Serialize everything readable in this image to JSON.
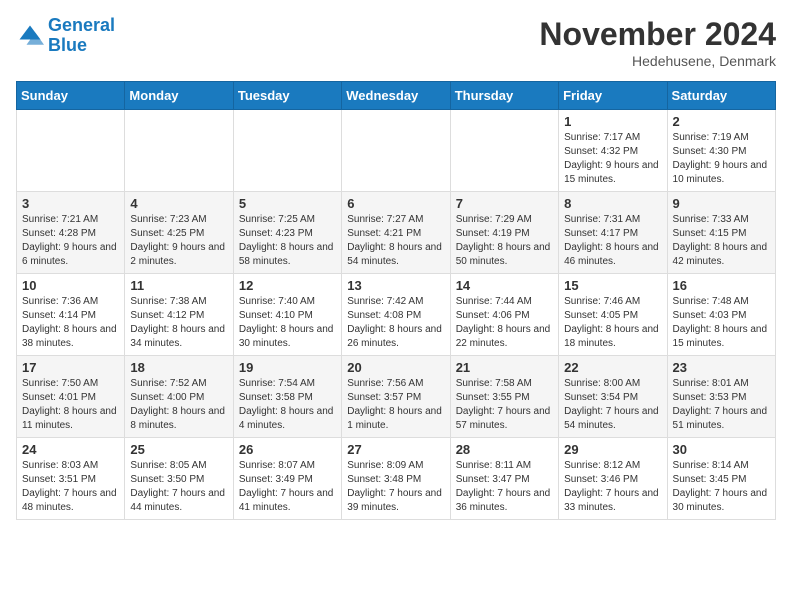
{
  "logo": {
    "line1": "General",
    "line2": "Blue"
  },
  "title": "November 2024",
  "location": "Hedehusene, Denmark",
  "days_of_week": [
    "Sunday",
    "Monday",
    "Tuesday",
    "Wednesday",
    "Thursday",
    "Friday",
    "Saturday"
  ],
  "weeks": [
    [
      {
        "day": "",
        "info": ""
      },
      {
        "day": "",
        "info": ""
      },
      {
        "day": "",
        "info": ""
      },
      {
        "day": "",
        "info": ""
      },
      {
        "day": "",
        "info": ""
      },
      {
        "day": "1",
        "info": "Sunrise: 7:17 AM\nSunset: 4:32 PM\nDaylight: 9 hours and 15 minutes."
      },
      {
        "day": "2",
        "info": "Sunrise: 7:19 AM\nSunset: 4:30 PM\nDaylight: 9 hours and 10 minutes."
      }
    ],
    [
      {
        "day": "3",
        "info": "Sunrise: 7:21 AM\nSunset: 4:28 PM\nDaylight: 9 hours and 6 minutes."
      },
      {
        "day": "4",
        "info": "Sunrise: 7:23 AM\nSunset: 4:25 PM\nDaylight: 9 hours and 2 minutes."
      },
      {
        "day": "5",
        "info": "Sunrise: 7:25 AM\nSunset: 4:23 PM\nDaylight: 8 hours and 58 minutes."
      },
      {
        "day": "6",
        "info": "Sunrise: 7:27 AM\nSunset: 4:21 PM\nDaylight: 8 hours and 54 minutes."
      },
      {
        "day": "7",
        "info": "Sunrise: 7:29 AM\nSunset: 4:19 PM\nDaylight: 8 hours and 50 minutes."
      },
      {
        "day": "8",
        "info": "Sunrise: 7:31 AM\nSunset: 4:17 PM\nDaylight: 8 hours and 46 minutes."
      },
      {
        "day": "9",
        "info": "Sunrise: 7:33 AM\nSunset: 4:15 PM\nDaylight: 8 hours and 42 minutes."
      }
    ],
    [
      {
        "day": "10",
        "info": "Sunrise: 7:36 AM\nSunset: 4:14 PM\nDaylight: 8 hours and 38 minutes."
      },
      {
        "day": "11",
        "info": "Sunrise: 7:38 AM\nSunset: 4:12 PM\nDaylight: 8 hours and 34 minutes."
      },
      {
        "day": "12",
        "info": "Sunrise: 7:40 AM\nSunset: 4:10 PM\nDaylight: 8 hours and 30 minutes."
      },
      {
        "day": "13",
        "info": "Sunrise: 7:42 AM\nSunset: 4:08 PM\nDaylight: 8 hours and 26 minutes."
      },
      {
        "day": "14",
        "info": "Sunrise: 7:44 AM\nSunset: 4:06 PM\nDaylight: 8 hours and 22 minutes."
      },
      {
        "day": "15",
        "info": "Sunrise: 7:46 AM\nSunset: 4:05 PM\nDaylight: 8 hours and 18 minutes."
      },
      {
        "day": "16",
        "info": "Sunrise: 7:48 AM\nSunset: 4:03 PM\nDaylight: 8 hours and 15 minutes."
      }
    ],
    [
      {
        "day": "17",
        "info": "Sunrise: 7:50 AM\nSunset: 4:01 PM\nDaylight: 8 hours and 11 minutes."
      },
      {
        "day": "18",
        "info": "Sunrise: 7:52 AM\nSunset: 4:00 PM\nDaylight: 8 hours and 8 minutes."
      },
      {
        "day": "19",
        "info": "Sunrise: 7:54 AM\nSunset: 3:58 PM\nDaylight: 8 hours and 4 minutes."
      },
      {
        "day": "20",
        "info": "Sunrise: 7:56 AM\nSunset: 3:57 PM\nDaylight: 8 hours and 1 minute."
      },
      {
        "day": "21",
        "info": "Sunrise: 7:58 AM\nSunset: 3:55 PM\nDaylight: 7 hours and 57 minutes."
      },
      {
        "day": "22",
        "info": "Sunrise: 8:00 AM\nSunset: 3:54 PM\nDaylight: 7 hours and 54 minutes."
      },
      {
        "day": "23",
        "info": "Sunrise: 8:01 AM\nSunset: 3:53 PM\nDaylight: 7 hours and 51 minutes."
      }
    ],
    [
      {
        "day": "24",
        "info": "Sunrise: 8:03 AM\nSunset: 3:51 PM\nDaylight: 7 hours and 48 minutes."
      },
      {
        "day": "25",
        "info": "Sunrise: 8:05 AM\nSunset: 3:50 PM\nDaylight: 7 hours and 44 minutes."
      },
      {
        "day": "26",
        "info": "Sunrise: 8:07 AM\nSunset: 3:49 PM\nDaylight: 7 hours and 41 minutes."
      },
      {
        "day": "27",
        "info": "Sunrise: 8:09 AM\nSunset: 3:48 PM\nDaylight: 7 hours and 39 minutes."
      },
      {
        "day": "28",
        "info": "Sunrise: 8:11 AM\nSunset: 3:47 PM\nDaylight: 7 hours and 36 minutes."
      },
      {
        "day": "29",
        "info": "Sunrise: 8:12 AM\nSunset: 3:46 PM\nDaylight: 7 hours and 33 minutes."
      },
      {
        "day": "30",
        "info": "Sunrise: 8:14 AM\nSunset: 3:45 PM\nDaylight: 7 hours and 30 minutes."
      }
    ]
  ]
}
